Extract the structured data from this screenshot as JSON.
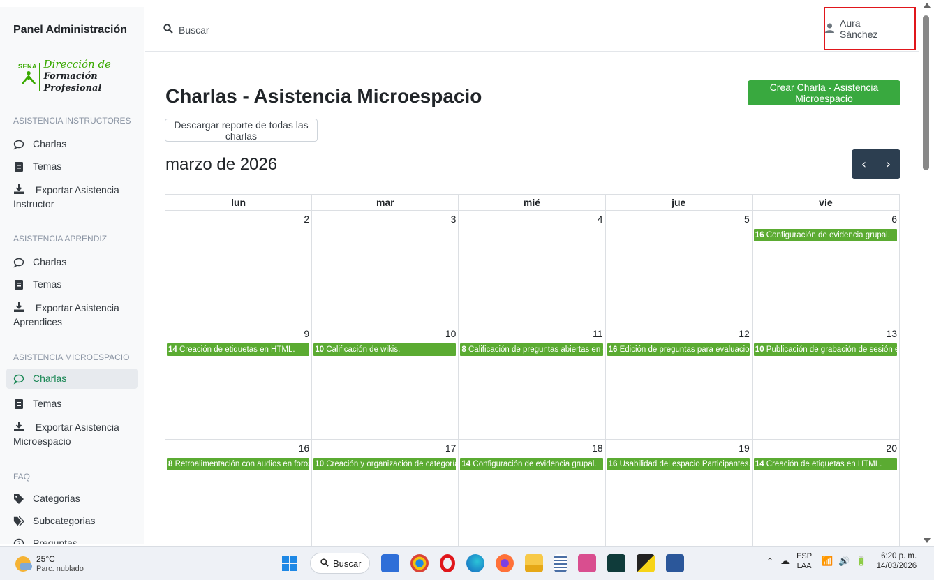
{
  "sidebar": {
    "title": "Panel Administración",
    "logo": {
      "brand": "SENA",
      "line1": "Dirección de",
      "line2": "Formación Profesional"
    },
    "sections": [
      {
        "label": "ASISTENCIA INSTRUCTORES",
        "items": [
          {
            "label": "Charlas",
            "icon": "chat-icon"
          },
          {
            "label": "Temas",
            "icon": "document-icon"
          },
          {
            "label": "Exportar Asistencia Instructor",
            "icon": "download-icon"
          }
        ]
      },
      {
        "label": "ASISTENCIA APRENDIZ",
        "items": [
          {
            "label": "Charlas",
            "icon": "chat-icon"
          },
          {
            "label": "Temas",
            "icon": "document-icon"
          },
          {
            "label": "Exportar Asistencia Aprendices",
            "icon": "download-icon"
          }
        ]
      },
      {
        "label": "ASISTENCIA MICROESPACIO",
        "items": [
          {
            "label": "Charlas",
            "icon": "chat-icon",
            "active": true
          },
          {
            "label": "Temas",
            "icon": "document-icon"
          },
          {
            "label": "Exportar Asistencia Microespacio",
            "icon": "download-icon"
          }
        ]
      },
      {
        "label": "FAQ",
        "items": [
          {
            "label": "Categorias",
            "icon": "tag-icon"
          },
          {
            "label": "Subcategorias",
            "icon": "tags-icon"
          },
          {
            "label": "Preguntas",
            "icon": "question-icon"
          }
        ]
      }
    ]
  },
  "header": {
    "search_label": "Buscar",
    "user_name": "Aura Sánchez"
  },
  "main": {
    "title": "Charlas - Asistencia Microespacio",
    "create_button": "Crear Charla - Asistencia Microespacio",
    "report_button": "Descargar reporte de todas las charlas",
    "month_label": "marzo de 2026",
    "prev_label": "‹",
    "next_label": "›"
  },
  "calendar": {
    "weekdays": [
      "lun",
      "mar",
      "mié",
      "jue",
      "vie"
    ],
    "weeks": [
      {
        "days": [
          {
            "num": "2",
            "events": []
          },
          {
            "num": "3",
            "events": []
          },
          {
            "num": "4",
            "events": []
          },
          {
            "num": "5",
            "events": []
          },
          {
            "num": "6",
            "events": [
              {
                "count": "16",
                "title": "Configuración de evidencia grupal."
              }
            ]
          }
        ]
      },
      {
        "days": [
          {
            "num": "9",
            "events": [
              {
                "count": "14",
                "title": "Creación de etiquetas en HTML."
              }
            ]
          },
          {
            "num": "10",
            "events": [
              {
                "count": "10",
                "title": "Calificación de wikis."
              }
            ]
          },
          {
            "num": "11",
            "events": [
              {
                "count": "8",
                "title": "Calificación de preguntas abiertas en evalu"
              }
            ]
          },
          {
            "num": "12",
            "events": [
              {
                "count": "16",
                "title": "Edición de preguntas para evaluaciones."
              }
            ]
          },
          {
            "num": "13",
            "events": [
              {
                "count": "10",
                "title": "Publicación de grabación de sesión en líne"
              }
            ]
          }
        ]
      },
      {
        "days": [
          {
            "num": "16",
            "events": [
              {
                "count": "8",
                "title": "Retroalimentación con audios en foros y ev"
              }
            ]
          },
          {
            "num": "17",
            "events": [
              {
                "count": "10",
                "title": "Creación y organización de categorías en"
              }
            ]
          },
          {
            "num": "18",
            "events": [
              {
                "count": "14",
                "title": "Configuración de evidencia grupal."
              }
            ]
          },
          {
            "num": "19",
            "events": [
              {
                "count": "16",
                "title": "Usabilidad del espacio Participantes."
              }
            ]
          },
          {
            "num": "20",
            "events": [
              {
                "count": "14",
                "title": "Creación de etiquetas en HTML."
              }
            ]
          }
        ]
      }
    ]
  },
  "taskbar": {
    "weather_temp": "25°C",
    "weather_desc": "Parc. nublado",
    "search_label": "Buscar",
    "lang_top": "ESP",
    "lang_bottom": "LAA",
    "time": "6:20 p. m.",
    "date": "14/03/2026"
  },
  "colors": {
    "accent_green": "#39a93f",
    "event_green": "#5bab32",
    "nav_dark": "#2c3e50",
    "highlight_red": "#e0161b"
  }
}
